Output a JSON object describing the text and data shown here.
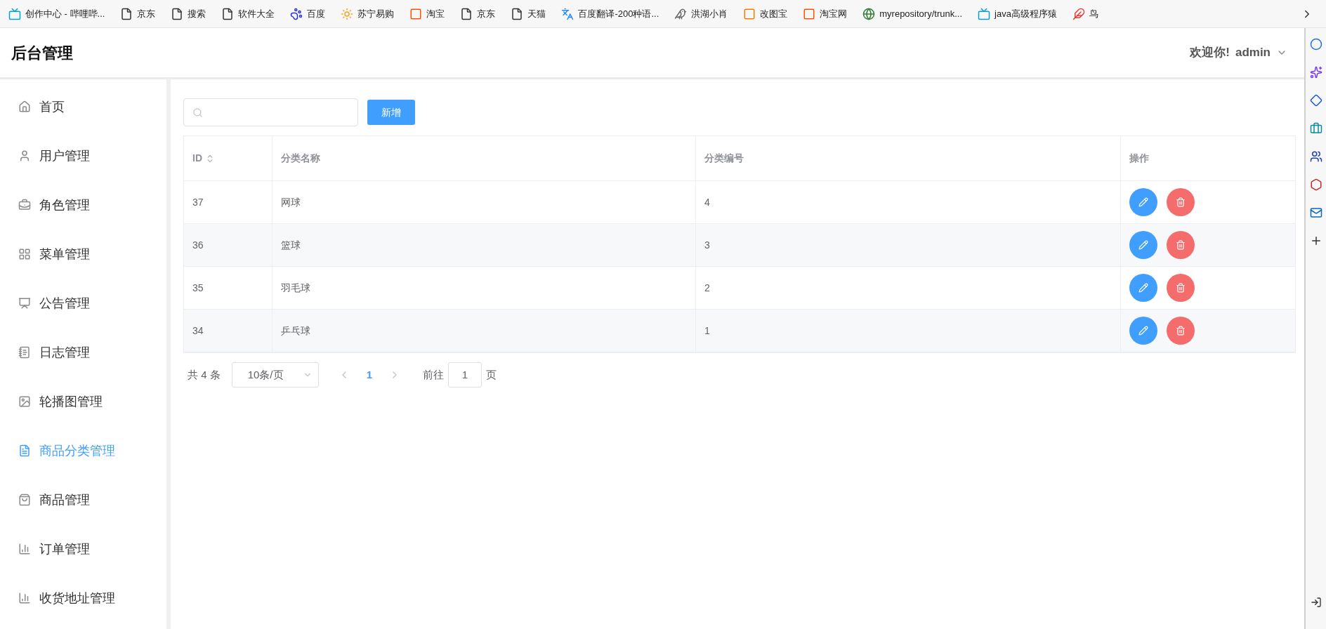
{
  "bookmarks": [
    {
      "kind": "tv",
      "label": "创作中心 - 哔哩哔..."
    },
    {
      "kind": "page",
      "label": "京东"
    },
    {
      "kind": "page",
      "label": "搜索"
    },
    {
      "kind": "page",
      "label": "软件大全"
    },
    {
      "kind": "paw",
      "label": "百度"
    },
    {
      "kind": "sun",
      "label": "苏宁易购"
    },
    {
      "kind": "tao",
      "label": "淘宝"
    },
    {
      "kind": "page",
      "label": "京东"
    },
    {
      "kind": "page",
      "label": "天猫"
    },
    {
      "kind": "translate",
      "label": "百度翻译-200种语..."
    },
    {
      "kind": "bird",
      "label": "洪湖小肖"
    },
    {
      "kind": "square",
      "label": "改图宝"
    },
    {
      "kind": "tao2",
      "label": "淘宝网"
    },
    {
      "kind": "globe",
      "label": "myrepository/trunk..."
    },
    {
      "kind": "tv",
      "label": "java高级程序猿"
    },
    {
      "kind": "bird2",
      "label": "鸟"
    }
  ],
  "header": {
    "title": "后台管理",
    "greeting": "欢迎你!",
    "user": "admin"
  },
  "sidebar": {
    "items": [
      {
        "kind": "home",
        "label": "首页",
        "selected": false
      },
      {
        "kind": "user",
        "label": "用户管理",
        "selected": false
      },
      {
        "kind": "briefcase",
        "label": "角色管理",
        "selected": false
      },
      {
        "kind": "grid",
        "label": "菜单管理",
        "selected": false
      },
      {
        "kind": "board",
        "label": "公告管理",
        "selected": false
      },
      {
        "kind": "notebook",
        "label": "日志管理",
        "selected": false
      },
      {
        "kind": "picture",
        "label": "轮播图管理",
        "selected": false
      },
      {
        "kind": "document",
        "label": "商品分类管理",
        "selected": true
      },
      {
        "kind": "bag",
        "label": "商品管理",
        "selected": false
      },
      {
        "kind": "bars",
        "label": "订单管理",
        "selected": false
      },
      {
        "kind": "bars",
        "label": "收货地址管理",
        "selected": false
      }
    ]
  },
  "toolbar": {
    "add_button": "新增"
  },
  "table": {
    "columns": [
      "ID",
      "分类名称",
      "分类编号",
      "操作"
    ],
    "rows": [
      {
        "id": "37",
        "name": "网球",
        "code": "4"
      },
      {
        "id": "36",
        "name": "篮球",
        "code": "3"
      },
      {
        "id": "35",
        "name": "羽毛球",
        "code": "2"
      },
      {
        "id": "34",
        "name": "乒乓球",
        "code": "1"
      }
    ]
  },
  "pagination": {
    "total": "共 4 条",
    "page_size": "10条/页",
    "pages": [
      {
        "label": "1",
        "selected": true
      }
    ],
    "goto": "前往",
    "goto_value": "1",
    "page_suffix": "页"
  }
}
